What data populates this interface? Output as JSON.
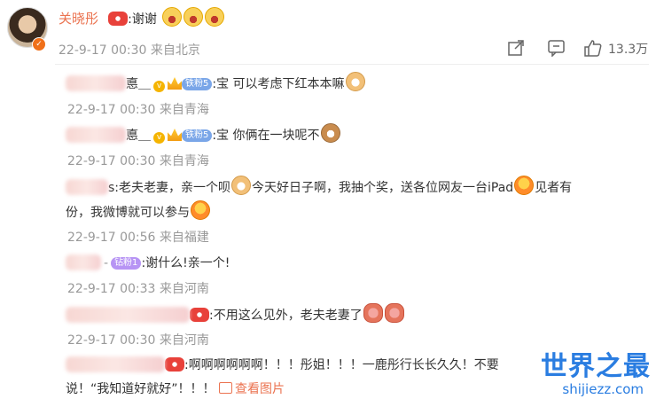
{
  "post": {
    "author": "关晓彤",
    "text": ":谢谢",
    "time": "22-9-17 00:30",
    "source": "来自北京",
    "likes": "13.3万"
  },
  "comments": [
    {
      "name_fragment": "悳＿",
      "badge": "铁粉5",
      "text": ":宝 可以考虑下红本本嘛",
      "time": "22-9-17 00:30",
      "source": "来自青海"
    },
    {
      "name_fragment": "悳＿",
      "badge": "铁粉5",
      "text": ":宝 你俩在一块呢不",
      "time": "22-9-17 00:30",
      "source": "来自青海"
    },
    {
      "name_fragment": "s",
      "text_line1": ":老夫老妻，亲一个呗",
      "text_line1b": "今天好日子啊，我抽个奖，送各位网友一台iPad",
      "text_line1c": "见者有",
      "text_line2": "份，我微博就可以参与",
      "time": "22-9-17 00:56",
      "source": "来自福建"
    },
    {
      "badge": "钻粉1",
      "text": ":谢什么!亲一个!",
      "time": "22-9-17 00:33",
      "source": "来自河南"
    },
    {
      "text": ":不用这么见外，老夫老妻了",
      "time": "22-9-17 00:30",
      "source": "来自河南"
    },
    {
      "text_line1": ":啊啊啊啊啊啊！！！彤姐！！！一鹿彤行长长久久！不要",
      "text_line2": "说！“我知道好就好”！！！",
      "view_image": "查看图片"
    }
  ],
  "watermark": {
    "title": "世界之最",
    "url": "shijiezz.com"
  },
  "icons": [
    "share-icon",
    "comment-icon",
    "like-icon"
  ]
}
